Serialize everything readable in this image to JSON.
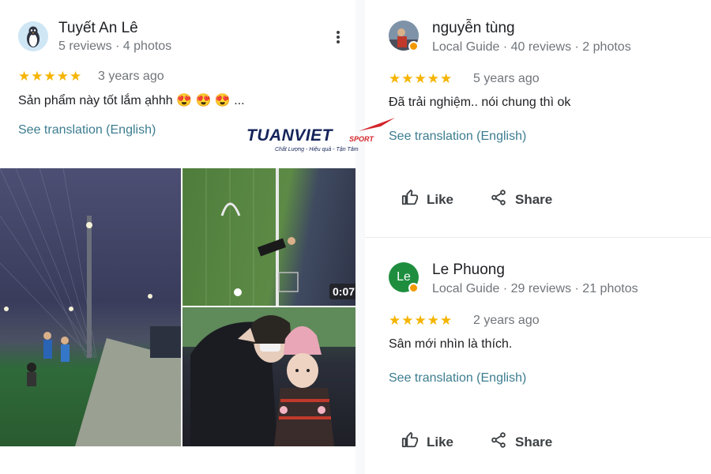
{
  "reviews": [
    {
      "name": "Tuyết An Lê",
      "meta": "5 reviews · 4 photos",
      "rating": 5,
      "stars": "★★★★★",
      "ago": "3 years ago",
      "text": "Sản phẩm này tốt lắm ạhhh 😍 😍 😍 ...",
      "translate": "See translation (English)",
      "video_duration": "0:07"
    },
    {
      "name": "nguyễn tùng",
      "meta": "Local Guide · 40 reviews · 2 photos",
      "rating": 5,
      "stars": "★★★★★",
      "ago": "5 years ago",
      "text": "Đã trải nghiệm.. nói chung thì ok",
      "translate": "See translation (English)",
      "like": "Like",
      "share": "Share"
    },
    {
      "name": "Le Phuong",
      "avatar_initials": "Le",
      "meta": "Local Guide · 29 reviews · 21 photos",
      "rating": 5,
      "stars": "★★★★★",
      "ago": "2 years ago",
      "text": "Sân mới nhìn là thích.",
      "translate": "See translation (English)",
      "like": "Like",
      "share": "Share"
    }
  ],
  "watermark": {
    "brand": "TUANVIET",
    "sport": "SPORT",
    "tagline": "Chất Lượng - Hiệu quả - Tận Tâm"
  },
  "colors": {
    "star": "#f5b400",
    "link": "#3c7d90",
    "avatar_le": "#1e8e3e",
    "brand_navy": "#14235a",
    "brand_red": "#d4242a"
  },
  "icons": [
    "penguin-avatar-icon",
    "more-vert-icon",
    "local-guide-badge-icon",
    "thumbs-up-icon",
    "share-icon",
    "play-video-icon"
  ]
}
